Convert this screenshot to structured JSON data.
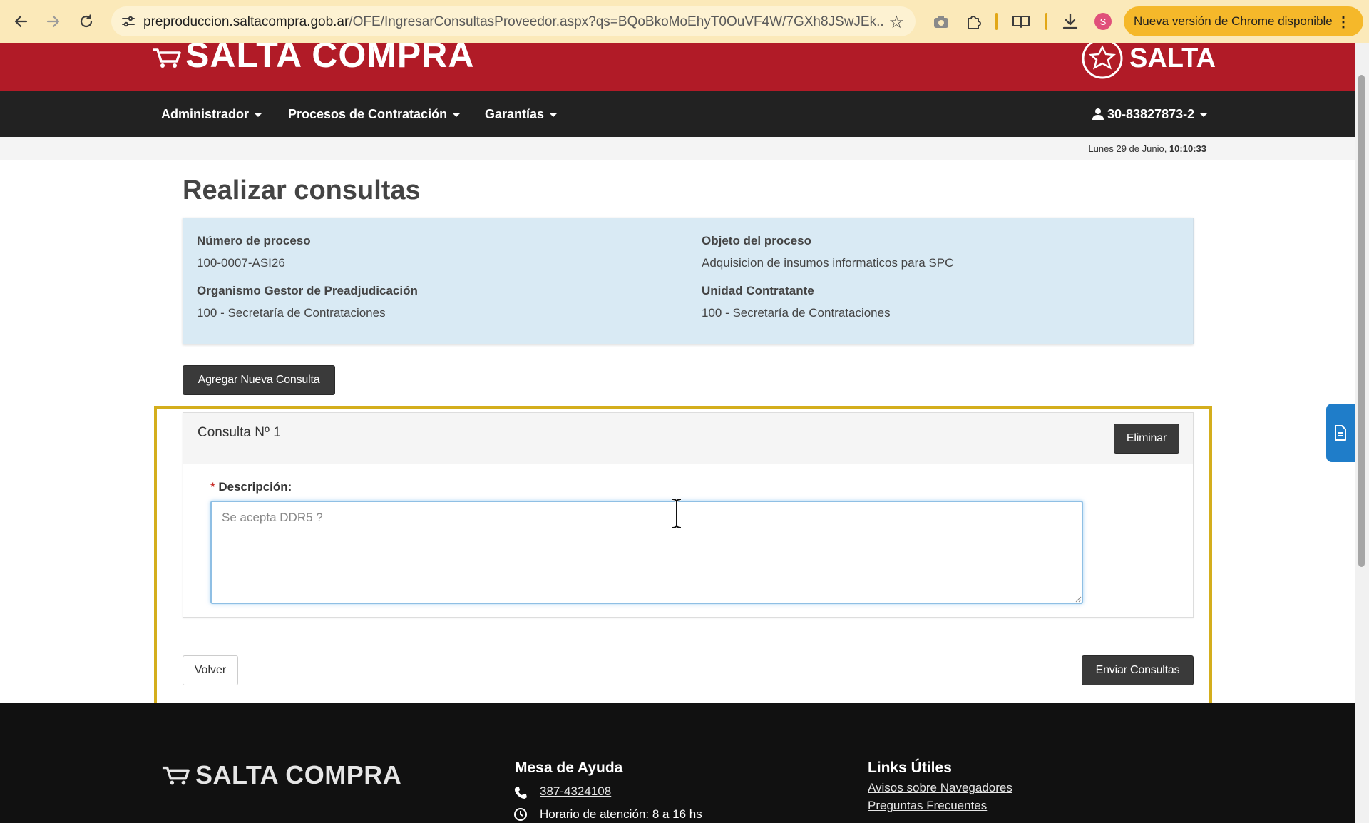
{
  "browser": {
    "url_host": "preproduccion.saltacompra.gob.ar",
    "url_path": "/OFE/IngresarConsultasProveedor.aspx?qs=BQoBkoMoEhyT0OuVF4W/7GXh8JSwJEk...",
    "update_label": "Nueva versión de Chrome disponible",
    "profile_initial": "S"
  },
  "header": {
    "brand": "SALTA COMPRA",
    "gov_logo": "SALTA"
  },
  "nav": {
    "items": [
      "Administrador",
      "Procesos de Contratación",
      "Garantías"
    ],
    "user": "30-83827873-2"
  },
  "date_bar": {
    "date": "Lunes 29 de Junio,",
    "time": "10:10:33"
  },
  "page": {
    "title": "Realizar consultas",
    "info": {
      "numero_label": "Número de proceso",
      "numero_value": "100-0007-ASI26",
      "objeto_label": "Objeto del proceso",
      "objeto_value": "Adquisicion de insumos informaticos para SPC",
      "organismo_label": "Organismo Gestor de Preadjudicación",
      "organismo_value": "100 - Secretaría de Contrataciones",
      "unidad_label": "Unidad Contratante",
      "unidad_value": "100 - Secretaría de Contrataciones"
    },
    "add_button": "Agregar Nueva Consulta",
    "consulta": {
      "title": "Consulta Nº 1",
      "delete_button": "Eliminar",
      "required_mark": "*",
      "desc_label": "Descripción:",
      "desc_placeholder": "Se acepta DDR5 ?"
    },
    "back_button": "Volver",
    "send_button": "Enviar Consultas"
  },
  "footer": {
    "brand": "SALTA COMPRA",
    "help_heading": "Mesa de Ayuda",
    "phone": "387-4324108",
    "hours": "Horario de atención: 8 a 16 hs",
    "links_heading": "Links Útiles",
    "links": [
      "Avisos sobre Navegadores",
      "Preguntas Frecuentes"
    ]
  },
  "colors": {
    "header_red": "#b11b27",
    "nav_dark": "#222222",
    "info_blue": "#d9eaf4",
    "highlight": "#d4ae1d",
    "side_tab": "#1f7dc9"
  }
}
